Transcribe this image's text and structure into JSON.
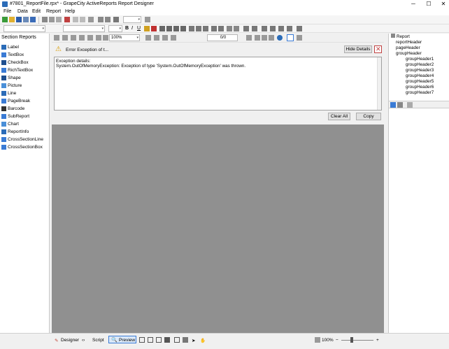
{
  "window": {
    "title": "#7801_ReportFile.rpx* - GrapeCity ActiveReports Report Designer",
    "controls": [
      "─",
      "☐",
      "✕"
    ]
  },
  "menu": [
    "File",
    "Data",
    "Edit",
    "Report",
    "Help"
  ],
  "toolbar": {
    "zoom_value": "100%",
    "page_counter": "0/0"
  },
  "left_panel": {
    "title": "Section Reports",
    "tools": [
      {
        "label": "Label",
        "color": "#2b6cb8"
      },
      {
        "label": "TextBox",
        "color": "#3a7bd5"
      },
      {
        "label": "CheckBox",
        "color": "#1f4f8f"
      },
      {
        "label": "RichTextBox",
        "color": "#3a7bd5"
      },
      {
        "label": "Shape",
        "color": "#1f4f8f"
      },
      {
        "label": "Picture",
        "color": "#4a8fd8"
      },
      {
        "label": "Line",
        "color": "#2b6cb8"
      },
      {
        "label": "PageBreak",
        "color": "#3a7bd5"
      },
      {
        "label": "Barcode",
        "color": "#333333"
      },
      {
        "label": "SubReport",
        "color": "#3a7bd5"
      },
      {
        "label": "Chart",
        "color": "#4a8fd8"
      },
      {
        "label": "ReportInfo",
        "color": "#2b6cb8"
      },
      {
        "label": "CrossSectionLine",
        "color": "#3a7bd5"
      },
      {
        "label": "CrossSectionBox",
        "color": "#3a7bd5"
      }
    ]
  },
  "error": {
    "header": "Error Exception of t...",
    "hide_details": "Hide Details",
    "details_label": "Exception details:",
    "details_text": "System.OutOfMemoryException: Exception of type 'System.OutOfMemoryException' was thrown.",
    "clear_all": "Clear All",
    "copy": "Copy"
  },
  "report_tree": {
    "root": "Report",
    "items": [
      "reportHeader",
      "pageHeader",
      "groupHeader",
      "groupHeader1",
      "groupHeader2",
      "groupHeader3",
      "groupHeader4",
      "groupHeader5",
      "groupHeader6",
      "groupHeader7"
    ]
  },
  "bottom": {
    "designer": "Designer",
    "script": "Script",
    "preview": "Preview",
    "zoom": "100%"
  }
}
